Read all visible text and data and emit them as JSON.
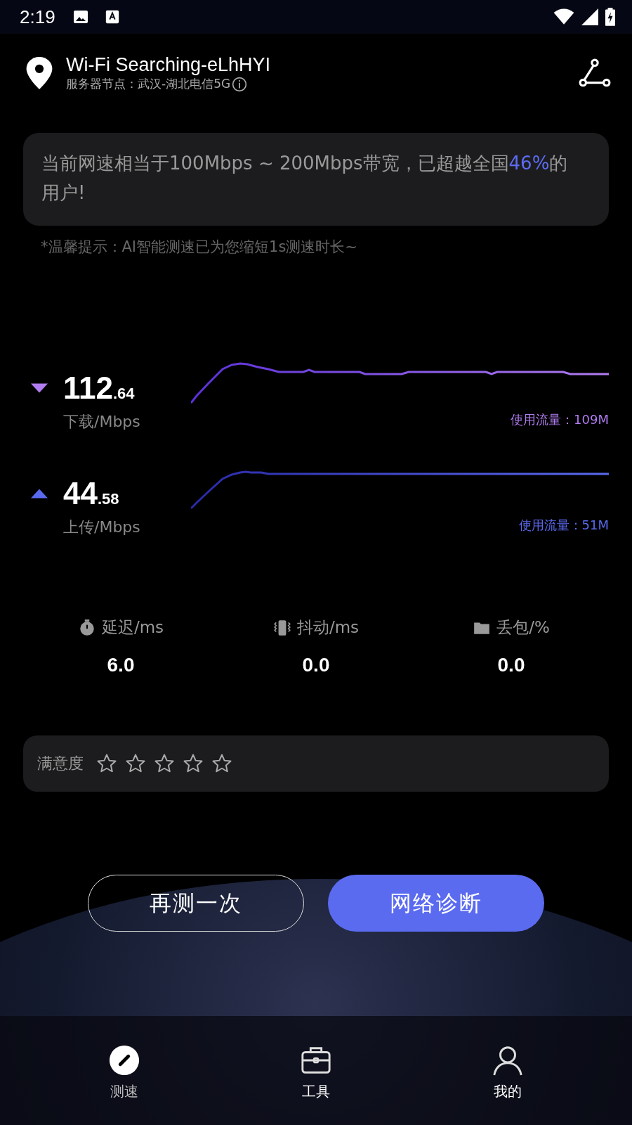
{
  "status_bar": {
    "time": "2:19"
  },
  "header": {
    "title": "Wi-Fi Searching-eLhHYI",
    "server_label": "服务器节点：武汉-湖北电信5G"
  },
  "summary": {
    "text_before": "当前网速相当于100Mbps ~ 200Mbps带宽，已超越全国",
    "highlight": "46%",
    "text_after": "的用户!"
  },
  "hint": "*温馨提示：AI智能测速已为您缩短1s测速时长~",
  "speeds": [
    {
      "kind": "download",
      "value_int": "112",
      "value_dec": ".64",
      "unit_label": "下载/Mbps",
      "usage": "使用流量：109M",
      "color": "#b07cf0"
    },
    {
      "kind": "upload",
      "value_int": "44",
      "value_dec": ".58",
      "unit_label": "上传/Mbps",
      "usage": "使用流量：51M",
      "color": "#5a6af0"
    }
  ],
  "metrics": [
    {
      "kind": "latency",
      "label": "延迟/ms",
      "value": "6.0"
    },
    {
      "kind": "jitter",
      "label": "抖动/ms",
      "value": "0.0"
    },
    {
      "kind": "loss",
      "label": "丢包/%",
      "value": "0.0"
    }
  ],
  "rating": {
    "label": "满意度",
    "stars": 0
  },
  "buttons": [
    {
      "kind": "outline",
      "label": "再测一次"
    },
    {
      "kind": "filled",
      "label": "网络诊断"
    }
  ],
  "tabs": [
    {
      "kind": "speed",
      "label": "测速",
      "selected": true
    },
    {
      "kind": "tools",
      "label": "工具",
      "selected": false
    },
    {
      "kind": "profile",
      "label": "我的",
      "selected": false
    }
  ]
}
